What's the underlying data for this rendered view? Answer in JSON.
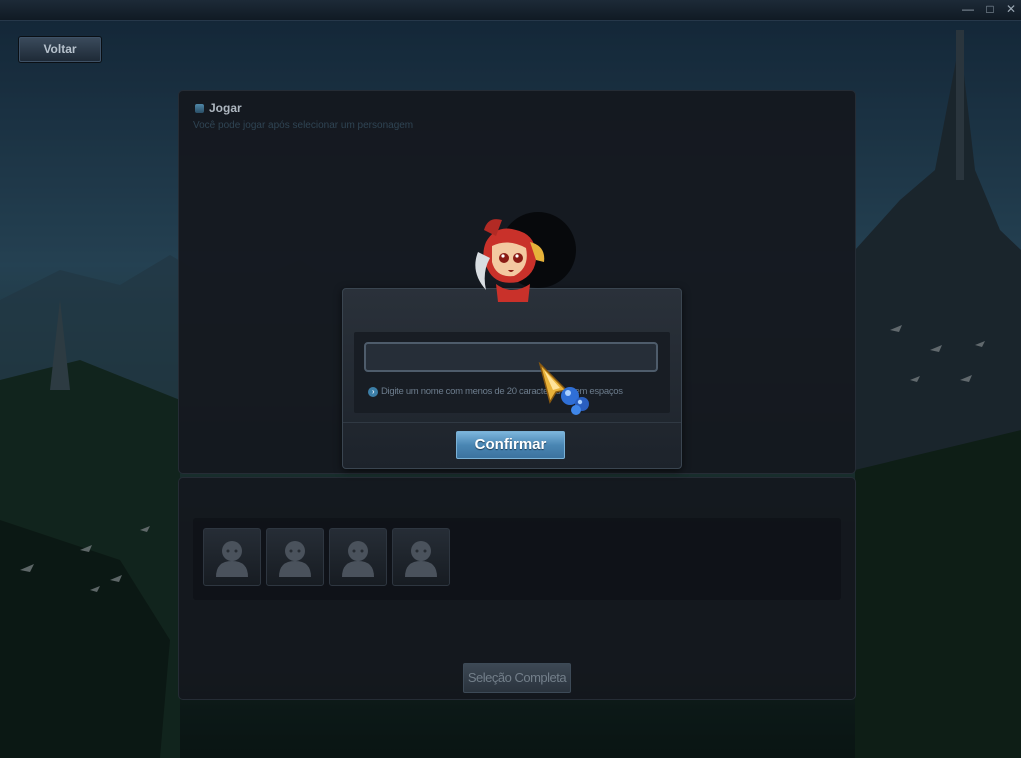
{
  "window": {
    "minimize_glyph": "—",
    "maximize_glyph": "□",
    "close_glyph": "✕"
  },
  "nav": {
    "back_label": "Voltar"
  },
  "panel": {
    "title": "Jogar",
    "subtitle": "Você pode jogar após selecionar um personagem"
  },
  "slots": [
    {
      "icon": "silhouette-icon"
    },
    {
      "icon": "silhouette-icon"
    },
    {
      "icon": "silhouette-icon"
    },
    {
      "icon": "silhouette-icon"
    }
  ],
  "complete_label": "Seleção Completa",
  "dialog": {
    "name_value": "",
    "hint": "Digite um nome com menos de 20 caracteres e sem espaços",
    "confirm_label": "Confirmar"
  },
  "colors": {
    "accent": "#4a86b3",
    "panel_bg": "#14181e",
    "text_dim": "#737f8a"
  }
}
